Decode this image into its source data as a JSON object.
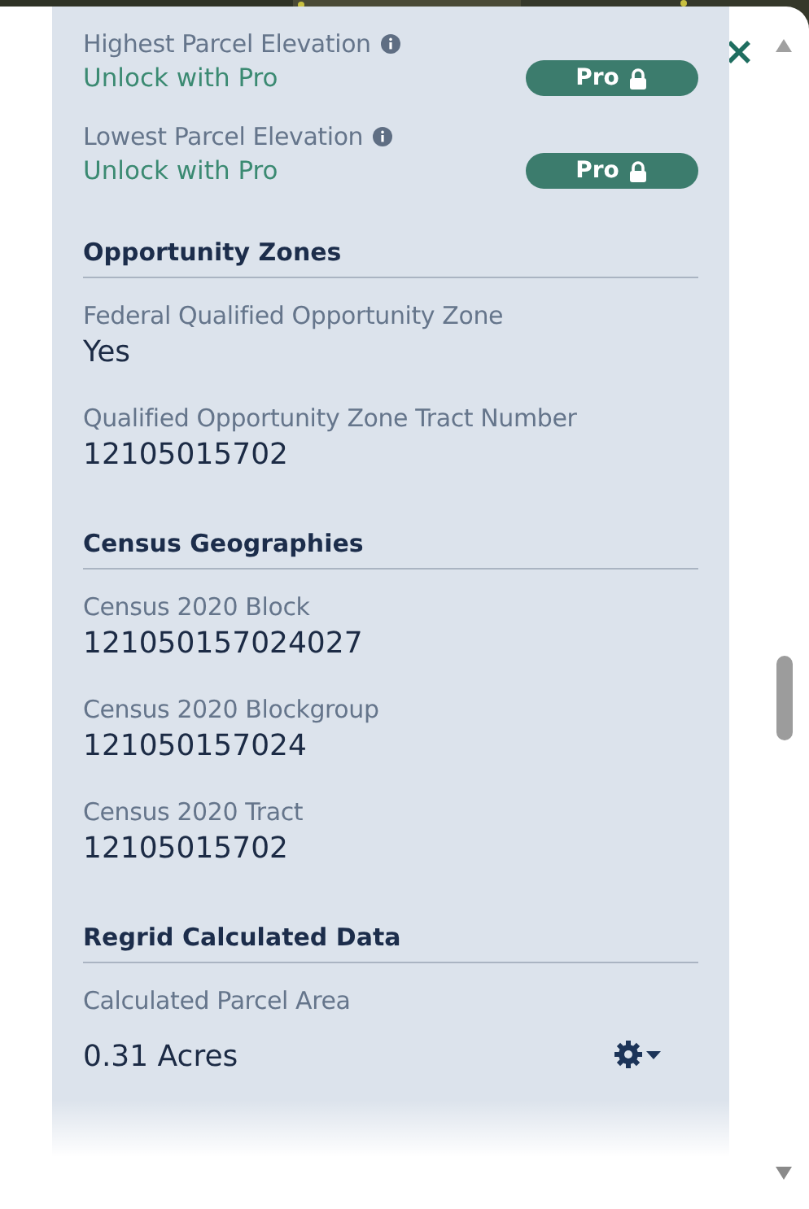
{
  "items": [
    {
      "kind": "pro",
      "label": "Highest Parcel Elevation",
      "value": "Unlock with Pro",
      "badge": "Pro"
    },
    {
      "kind": "pro",
      "label": "Lowest Parcel Elevation",
      "value": "Unlock with Pro",
      "badge": "Pro"
    },
    {
      "kind": "heading",
      "label": "Opportunity Zones"
    },
    {
      "kind": "field",
      "label": "Federal Qualified Opportunity Zone",
      "value": "Yes"
    },
    {
      "kind": "field",
      "label": "Qualified Opportunity Zone Tract Number",
      "value": "12105015702"
    },
    {
      "kind": "heading",
      "label": "Census Geographies"
    },
    {
      "kind": "field",
      "label": "Census 2020 Block",
      "value": "121050157024027"
    },
    {
      "kind": "field",
      "label": "Census 2020 Blockgroup",
      "value": "121050157024"
    },
    {
      "kind": "field",
      "label": "Census 2020 Tract",
      "value": "12105015702"
    },
    {
      "kind": "heading",
      "label": "Regrid Calculated Data"
    },
    {
      "kind": "settings",
      "label": "Calculated Parcel Area",
      "value": "0.31 Acres"
    }
  ]
}
